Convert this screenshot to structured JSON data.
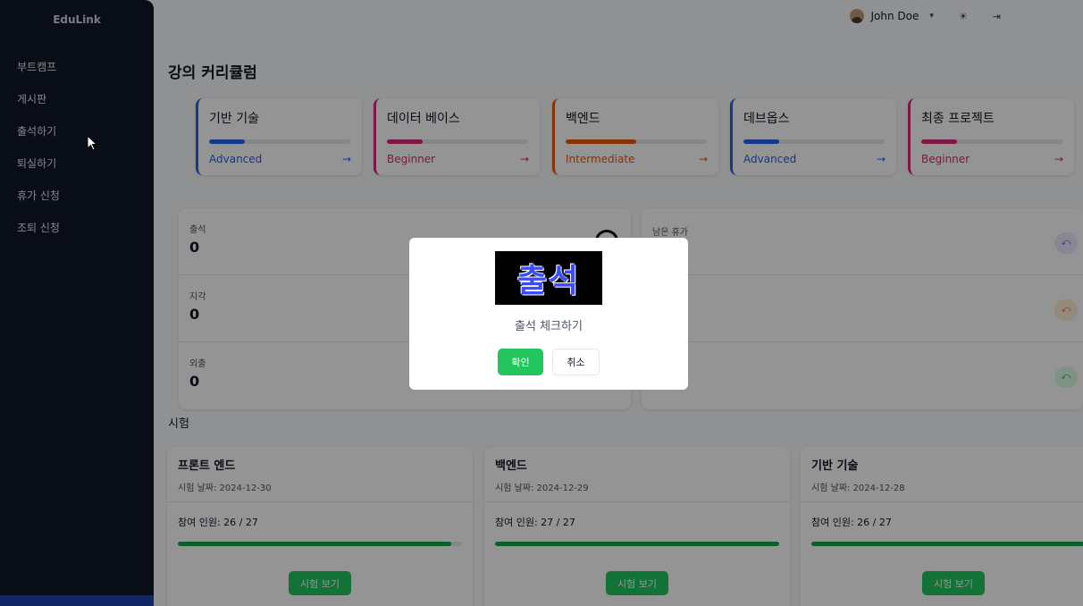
{
  "sidebar": {
    "brand": "EduLink",
    "items": [
      {
        "label": "부트캠프"
      },
      {
        "label": "게시판"
      },
      {
        "label": "출석하기"
      },
      {
        "label": "퇴실하기"
      },
      {
        "label": "휴가 신청"
      },
      {
        "label": "조퇴 신청"
      }
    ]
  },
  "header": {
    "user_name": "John Doe",
    "icons": [
      "avatar",
      "chevron-down-icon",
      "theme-toggle-icon",
      "logout-icon"
    ]
  },
  "page_title": "강의 커리큘럼",
  "courses": [
    {
      "name": "기반 기술",
      "level": "Advanced",
      "arrow": "→",
      "progress": 0.25,
      "color": "#2563eb"
    },
    {
      "name": "데이터 베이스",
      "level": "Beginner",
      "arrow": "→",
      "progress": 0.25,
      "color": "#db2777"
    },
    {
      "name": "백엔드",
      "level": "Intermediate",
      "arrow": "→",
      "progress": 0.5,
      "color": "#ea580c"
    },
    {
      "name": "데브옵스",
      "level": "Advanced",
      "arrow": "→",
      "progress": 0.25,
      "color": "#2563eb"
    },
    {
      "name": "최종 프로젝트",
      "level": "Beginner",
      "arrow": "→",
      "progress": 0.25,
      "color": "#db2777"
    }
  ],
  "stats_left": [
    {
      "label": "출석",
      "value": "0"
    },
    {
      "label": "지각",
      "value": "0"
    },
    {
      "label": "외출",
      "value": "0"
    }
  ],
  "stats_right": [
    {
      "label": "남은 휴가",
      "value": ""
    },
    {
      "label": "",
      "value": ""
    },
    {
      "label": "",
      "value": ""
    }
  ],
  "exam_section_title": "시험",
  "exams": [
    {
      "name": "프론트 엔드",
      "date_label": "시험 날짜: 2024-12-30",
      "count_label": "참여 인원: 26 / 27",
      "progress": 0.963,
      "button": "시험 보기"
    },
    {
      "name": "백엔드",
      "date_label": "시험 날짜: 2024-12-29",
      "count_label": "참여 인원: 27 / 27",
      "progress": 1.0,
      "button": "시험 보기"
    },
    {
      "name": "기반 기술",
      "date_label": "시험 날짜: 2024-12-28",
      "count_label": "참여 인원: 26 / 27",
      "progress": 0.963,
      "button": "시험 보기"
    }
  ],
  "modal": {
    "logo_text": "출석",
    "message": "출석 체크하기",
    "ok": "확인",
    "cancel": "취소"
  }
}
